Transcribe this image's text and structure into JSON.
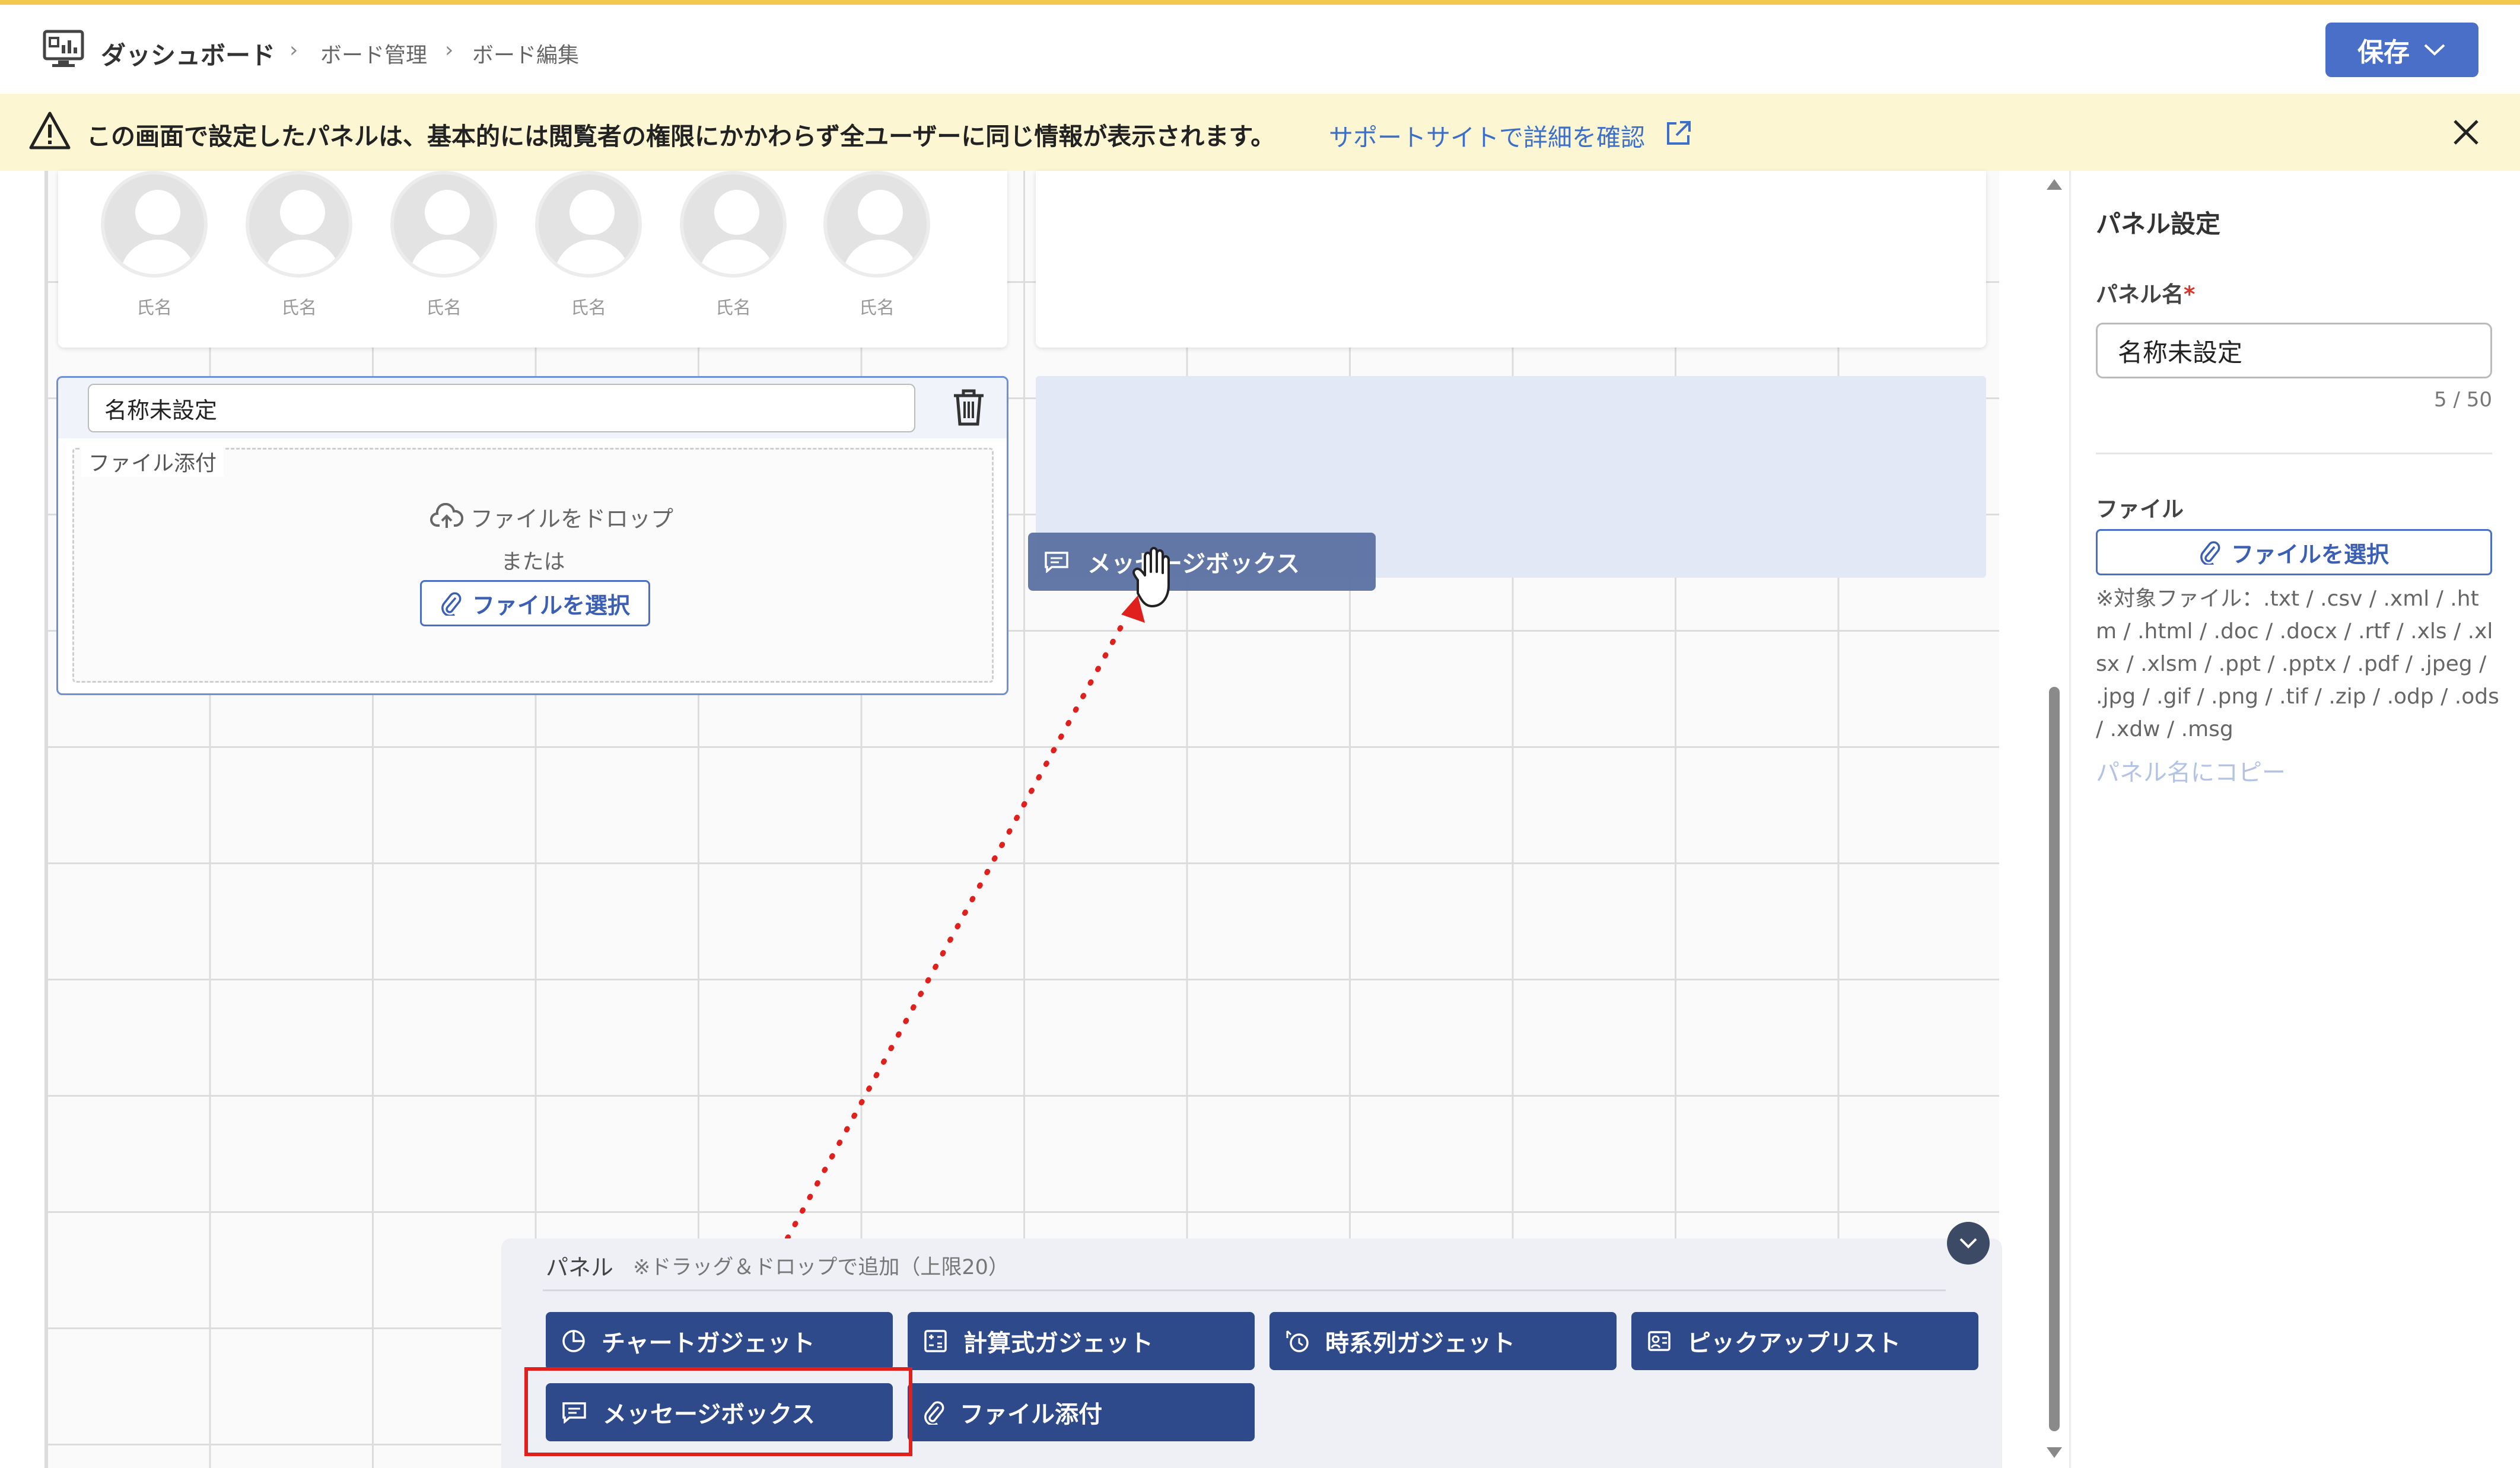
{
  "header": {
    "title": "ダッシュボード",
    "breadcrumb": [
      "ボード管理",
      "ボード編集"
    ],
    "save_label": "保存"
  },
  "banner": {
    "message": "この画面で設定したパネルは、基本的には閲覧者の権限にかかわらず全ユーザーに同じ情報が表示されます。",
    "link_text": "サポートサイトで詳細を確認"
  },
  "avatars": {
    "names": [
      "氏名",
      "氏名",
      "氏名",
      "氏名",
      "氏名",
      "氏名"
    ]
  },
  "file_panel": {
    "title_value": "名称未設定",
    "legend": "ファイル添付",
    "drop_text": "ファイルをドロップ",
    "or_text": "または",
    "select_label": "ファイルを選択"
  },
  "drag": {
    "ghost_label": "メッセージボックス"
  },
  "palette": {
    "label": "パネル",
    "hint": "※ドラッグ＆ドロップで追加（上限20）",
    "items": [
      {
        "label": "チャートガジェット",
        "icon": "chart-pie-icon"
      },
      {
        "label": "計算式ガジェット",
        "icon": "calculator-icon"
      },
      {
        "label": "時系列ガジェット",
        "icon": "time-series-icon"
      },
      {
        "label": "ピックアップリスト",
        "icon": "pickup-list-icon"
      },
      {
        "label": "メッセージボックス",
        "icon": "message-icon"
      },
      {
        "label": "ファイル添付",
        "icon": "paperclip-icon"
      }
    ]
  },
  "settings": {
    "heading": "パネル設定",
    "name_label": "パネル名",
    "required_mark": "*",
    "name_value": "名称未設定",
    "counter": "5 / 50",
    "file_label": "ファイル",
    "file_button": "ファイルを選択",
    "file_types": "※対象ファイル：.txt / .csv / .xml / .htm / .html / .doc / .docx / .rtf / .xls / .xlsx / .xlsm / .ppt / .pptx / .pdf / .jpeg / .jpg / .gif / .png / .tif / .zip / .odp / .ods / .xdw / .msg",
    "copy_link": "パネル名にコピー"
  },
  "colors": {
    "accent": "#4a6fc9",
    "palette_button": "#2f4a8a",
    "banner_bg": "#fdf6d3",
    "highlight": "#e0201c",
    "drop_target": "#e2e8f6"
  }
}
